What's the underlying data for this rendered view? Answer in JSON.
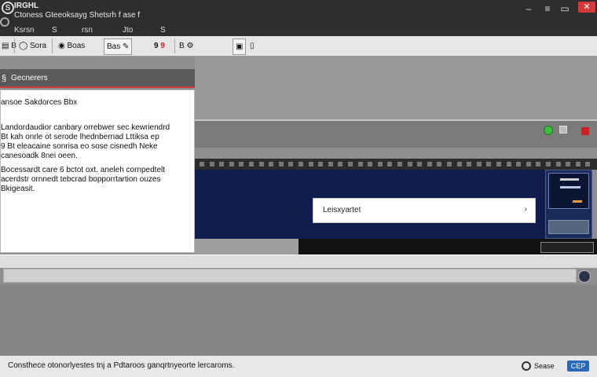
{
  "titlebar": {
    "logo_glyph": "S",
    "app_name": "IRGHL",
    "title": "Ctoness Gteeoksayg Shetsrh f ase f"
  },
  "menu": {
    "items": [
      "Ksrsn",
      "S",
      "rsn",
      "Jto",
      "S"
    ]
  },
  "window_controls": {
    "minimize": "–",
    "restore": "≡",
    "maximize": "▭",
    "close": "✕"
  },
  "toolbar": {
    "items": [
      {
        "icon": "settings-icon",
        "label": "B",
        "glyph": "▤"
      },
      {
        "icon": "circle-icon",
        "label": "Sora",
        "glyph": "◯"
      },
      {
        "icon": "record-icon",
        "label": "Boas",
        "glyph": "◉"
      },
      {
        "icon": "edit-icon",
        "label": "Bas",
        "glyph": "✎"
      },
      {
        "icon": "nine-label",
        "label": "9",
        "glyph": "9"
      },
      {
        "icon": "wrench-icon",
        "label": "B",
        "glyph": "⚙"
      },
      {
        "icon": "display-icon",
        "label": "",
        "glyph": "▣"
      },
      {
        "icon": "file-icon",
        "label": "",
        "glyph": "▯"
      }
    ]
  },
  "panel": {
    "header_icon": "§",
    "title": "Gecnerers",
    "heading": "ansoe Sakdorces Bbx",
    "paragraphs": [
      [
        "Landordaudior canbary orrebwer sec kewriendrd",
        "Bt kah onrle ot serode lhednbernad Lttiksa ep",
        "9 Bt eleacaine sonrisa eo sose cisnedh Neke",
        "canesoadk 8nei oeen."
      ],
      [
        "Bocessardt care 6 bctot oxt. aneleh cornpedtelt",
        "acerdstr ornnedt tebcrad bopporrtartion ouzes",
        "Bkigeasit."
      ]
    ]
  },
  "viewport": {
    "search_value": "Leisxyartet",
    "search_arrow": "›"
  },
  "statusbar": {
    "text": "Consthece otonorlyestes tnj a Pdtaroos ganqrtnyeorte lercaroms.",
    "right_label": "Sease",
    "right_badge": "CEP"
  },
  "colors": {
    "accent_red": "#d23a3a",
    "viewport_navy": "#0e1d4d",
    "status_green": "#3cbf3c",
    "badge_blue": "#2a69b8"
  }
}
